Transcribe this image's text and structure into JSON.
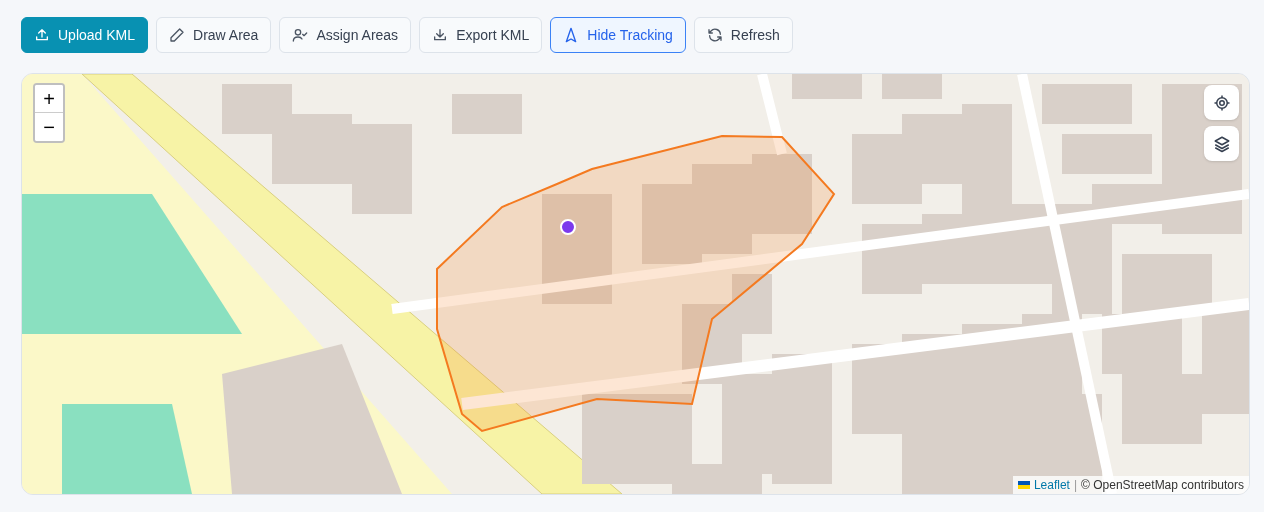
{
  "toolbar": [
    {
      "label": "Upload KML",
      "kind": "primary",
      "active": false
    },
    {
      "label": "Draw Area",
      "kind": "outline",
      "active": false
    },
    {
      "label": "Assign Areas",
      "kind": "outline",
      "active": false
    },
    {
      "label": "Export KML",
      "kind": "outline",
      "active": false
    },
    {
      "label": "Hide Tracking",
      "kind": "outline",
      "active": true
    },
    {
      "label": "Refresh",
      "kind": "outline",
      "active": false
    }
  ],
  "map": {
    "zoom_in": "+",
    "zoom_out": "−",
    "attribution": {
      "link": "Leaflet",
      "separator": "|",
      "text": "© OpenStreetMap contributors"
    }
  }
}
